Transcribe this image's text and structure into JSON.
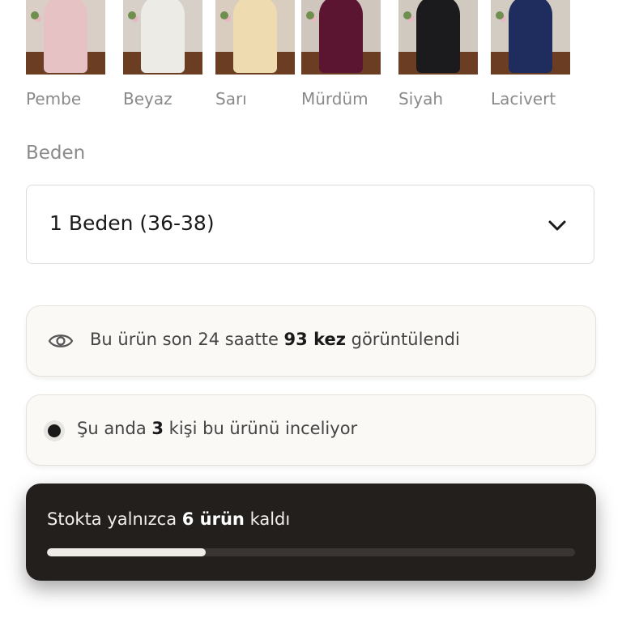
{
  "colors": {
    "swatches": [
      {
        "name": "Pembe",
        "dress": "#e7c2c4",
        "wall": "#d9cfc6"
      },
      {
        "name": "Beyaz",
        "dress": "#ecebe6",
        "wall": "#d6d0c8"
      },
      {
        "name": "Sarı",
        "dress": "#eedcb0",
        "wall": "#d8cdbf"
      },
      {
        "name": "Mürdüm",
        "dress": "#5c1530",
        "wall": "#cfc7bd"
      },
      {
        "name": "Siyah",
        "dress": "#1b1b1d",
        "wall": "#d0c9c0"
      },
      {
        "name": "Lacivert",
        "dress": "#1f2c5e",
        "wall": "#d3ccc3"
      }
    ],
    "selected_index": 3
  },
  "size": {
    "label": "Beden",
    "selected": "1 Beden (36-38)",
    "chevron_icon": "chevron-down-icon"
  },
  "views": {
    "icon": "eye-icon",
    "prefix": "Bu ürün son 24 saatte ",
    "count": "93 kez",
    "suffix": " görüntülendi"
  },
  "live": {
    "icon": "live-dot-icon",
    "prefix": "Şu anda ",
    "count": "3",
    "suffix": " kişi bu ürünü inceliyor"
  },
  "stock": {
    "prefix": "Stokta yalnızca ",
    "count": "6 ürün",
    "suffix": " kaldı",
    "progress_fraction": 0.3
  }
}
